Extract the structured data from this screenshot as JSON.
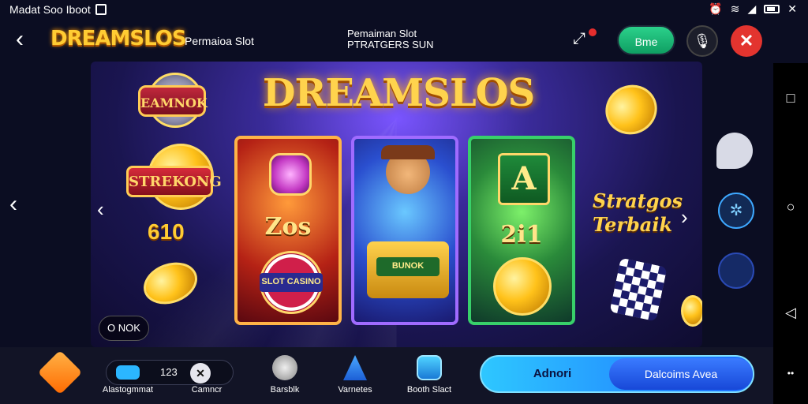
{
  "status_bar": {
    "left_text": "Madat Soo Iboot",
    "icons": [
      "image-icon",
      "alarm-icon",
      "wifi-icon",
      "signal-icon",
      "battery-icon",
      "close-icon"
    ]
  },
  "header": {
    "logo": "DREAMSLOS",
    "subtitle": "Permaioa Slot",
    "center_line1": "Pemaiman Slot",
    "center_line2": "PTRATGERS SUN",
    "green_button": "Bme"
  },
  "banner": {
    "title": "DREAMSLOS",
    "left_badge_top": "EAMNOK",
    "left_badge_mid": "STREKONG",
    "left_number": "610",
    "chip_label": "O NOK",
    "cards": [
      {
        "value": "Zos",
        "tag": "SLOT CASINO"
      },
      {
        "value": "",
        "tag": "BUNOK"
      },
      {
        "value": "2i1",
        "tag": "A"
      }
    ],
    "right_text_1": "Stratgos",
    "right_text_2": "Terbaik"
  },
  "bottom": {
    "items": [
      {
        "label": "Alastogmmat",
        "icon": "diamond-icon"
      },
      {
        "label": "Camncr",
        "icon": "close-circle-icon",
        "count": "123"
      },
      {
        "label": "Barsblk",
        "icon": "chat-icon"
      },
      {
        "label": "Varnetes",
        "icon": "pen-icon"
      },
      {
        "label": "Booth Slact",
        "icon": "gift-icon"
      }
    ],
    "cta_left": "Adnori",
    "cta_right": "Dalcoims Avea"
  },
  "colors": {
    "accent": "#ffcc33",
    "close": "#e3342f",
    "green": "#1fb876",
    "cta": "#2ec7ff"
  }
}
